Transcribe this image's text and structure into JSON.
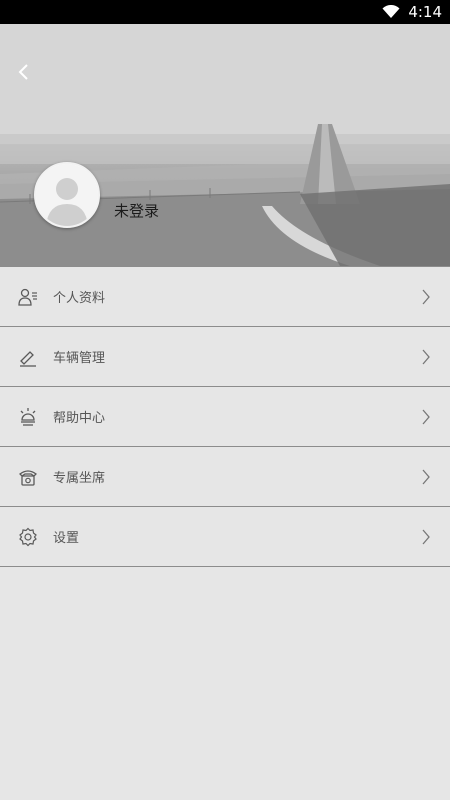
{
  "status_bar": {
    "time": "4:14"
  },
  "header": {
    "login_status": "未登录"
  },
  "menu": {
    "items": [
      {
        "label": "个人资料",
        "icon": "profile-icon"
      },
      {
        "label": "车辆管理",
        "icon": "car-management-icon"
      },
      {
        "label": "帮助中心",
        "icon": "help-icon"
      },
      {
        "label": "专属坐席",
        "icon": "phone-icon"
      },
      {
        "label": "设置",
        "icon": "gear-icon"
      }
    ]
  },
  "colors": {
    "status_bar": "#000000",
    "background": "#e6e6e6",
    "divider": "#8c8c8c",
    "label_text": "#555555",
    "icon_stroke": "#5a5a5a"
  }
}
